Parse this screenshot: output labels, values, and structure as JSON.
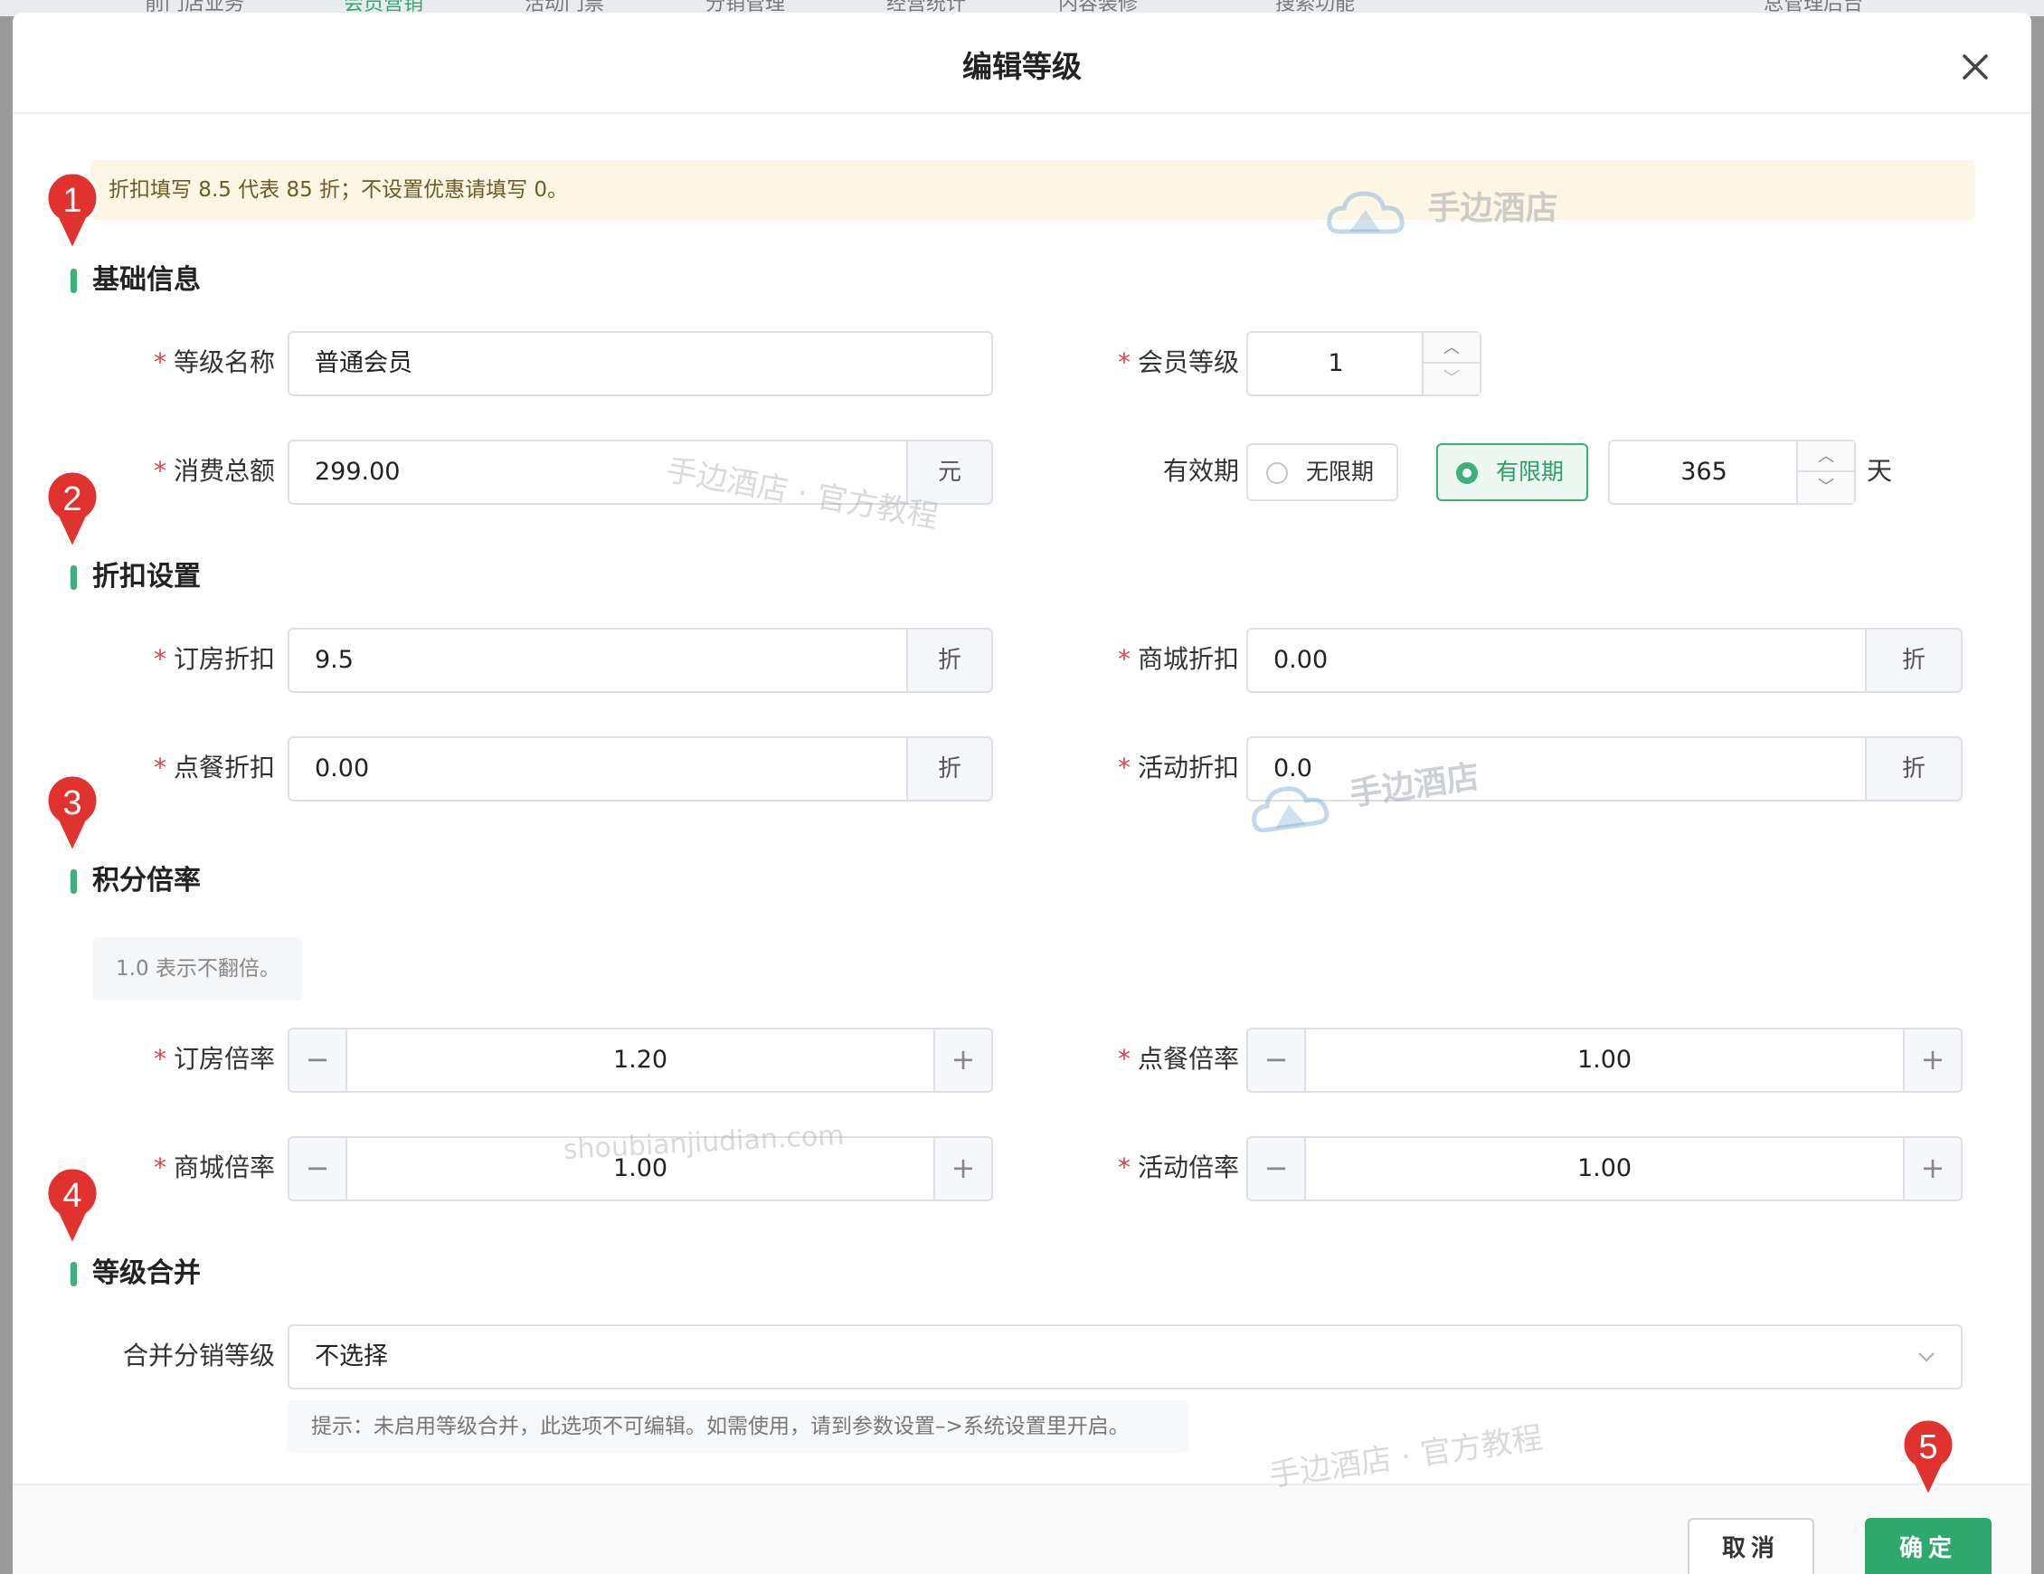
{
  "background": {
    "topbar_items": [
      {
        "label": "前门店业务",
        "x_hint": "a"
      },
      {
        "label": "会员营销",
        "x_hint": "b"
      },
      {
        "label": "活动门票",
        "x_hint": "c"
      },
      {
        "label": "分销管理",
        "x_hint": "d"
      },
      {
        "label": "经营统计",
        "x_hint": "e"
      },
      {
        "label": "内容装修",
        "x_hint": "f"
      },
      {
        "label": "搜索功能",
        "x_hint": "g"
      },
      {
        "label": "总管理后台",
        "x_hint": "h"
      }
    ]
  },
  "modal": {
    "title": "编辑等级",
    "tip": "折扣填写 8.5 代表 85 折；不设置优惠请填写 0。"
  },
  "sections": {
    "basic": "基础信息",
    "discount": "折扣设置",
    "points": "积分倍率",
    "merge": "等级合并"
  },
  "basic": {
    "level_name": {
      "label": "等级名称",
      "value": "普通会员"
    },
    "member_level": {
      "label": "会员等级",
      "value": "1"
    },
    "total_spend": {
      "label": "消费总额",
      "value": "299.00",
      "unit": "元"
    },
    "validity": {
      "label": "有效期",
      "options": [
        "无限期",
        "有限期"
      ],
      "selected": "有限期",
      "days": "365",
      "days_unit": "天"
    }
  },
  "discount": {
    "room": {
      "label": "订房折扣",
      "value": "9.5",
      "unit": "折"
    },
    "mall": {
      "label": "商城折扣",
      "value": "0.00",
      "unit": "折"
    },
    "dining": {
      "label": "点餐折扣",
      "value": "0.00",
      "unit": "折"
    },
    "activity": {
      "label": "活动折扣",
      "value": "0.0",
      "unit": "折"
    }
  },
  "points": {
    "hint": "1.0 表示不翻倍。",
    "room": {
      "label": "订房倍率",
      "value": "1.20"
    },
    "dining": {
      "label": "点餐倍率",
      "value": "1.00"
    },
    "mall": {
      "label": "商城倍率",
      "value": "1.00"
    },
    "activity": {
      "label": "活动倍率",
      "value": "1.00"
    },
    "minus": "−",
    "plus": "+"
  },
  "merge": {
    "label": "合并分销等级",
    "value": "不选择",
    "note": "提示：未启用等级合并，此选项不可编辑。如需使用，请到参数设置–>系统设置里开启。"
  },
  "footer": {
    "cancel": "取消",
    "ok": "确定"
  },
  "markers": [
    "1",
    "2",
    "3",
    "4",
    "5"
  ],
  "watermarks": {
    "brand": "手边酒店",
    "tutorial": "手边酒店 · 官方教程",
    "domain": "shoubianjiudian.com"
  },
  "colors": {
    "accent": "#2fa86e",
    "required": "#e0424b",
    "marker": "#e0322f",
    "tip_bg": "#fdf6e4"
  }
}
